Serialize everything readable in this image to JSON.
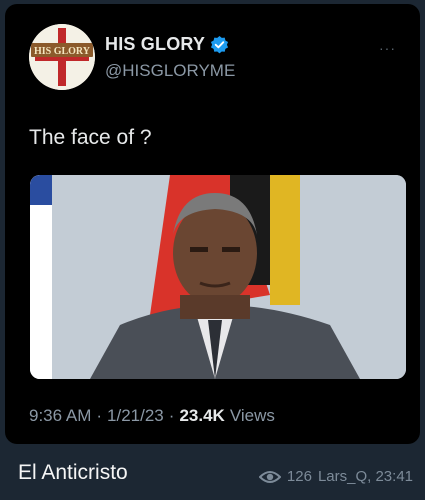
{
  "tweet": {
    "display_name": "HIS GLORY",
    "handle": "@HISGLORYME",
    "avatar_text": "HIS GLORY",
    "more_icon": "more-dots-icon",
    "verified_icon": "verified-badge-icon",
    "text": "The face of ?",
    "time": "9:36 AM",
    "separator1": "·",
    "date": "1/21/23",
    "separator2": "·",
    "views_count": "23.4K",
    "views_label": "Views"
  },
  "message": {
    "caption": "El Anticristo",
    "views": "126",
    "author_time": "Lars_Q, 23:41",
    "views_icon": "eye-icon"
  },
  "colors": {
    "background": "#1c2733",
    "tweet_bg": "#000000",
    "verified": "#1d9bf0",
    "muted": "#8b98a5"
  }
}
